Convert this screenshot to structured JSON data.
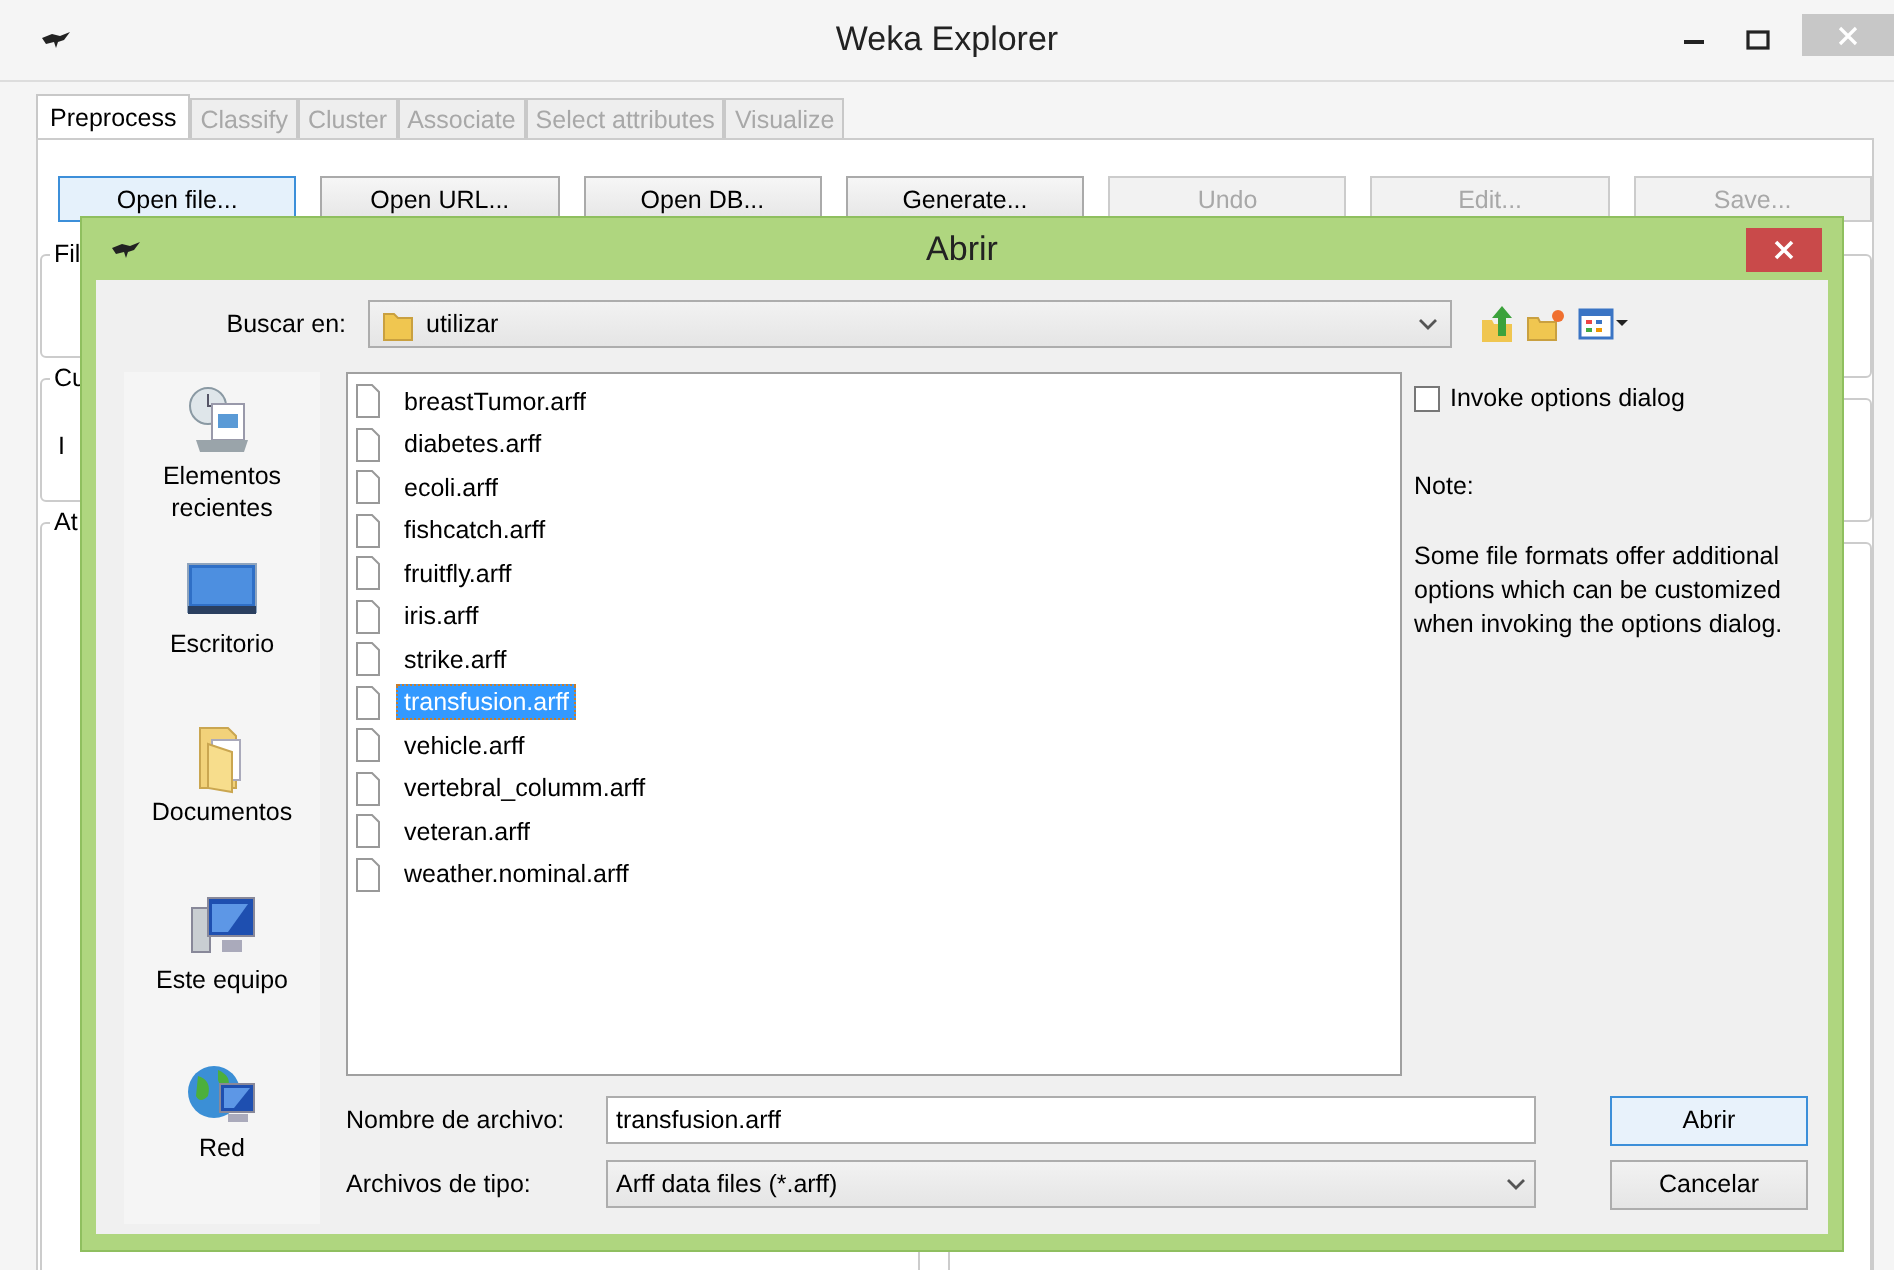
{
  "window": {
    "title": "Weka Explorer"
  },
  "tabs": [
    {
      "label": "Preprocess",
      "selected": true,
      "disabled": false
    },
    {
      "label": "Classify",
      "selected": false,
      "disabled": true
    },
    {
      "label": "Cluster",
      "selected": false,
      "disabled": true
    },
    {
      "label": "Associate",
      "selected": false,
      "disabled": true
    },
    {
      "label": "Select attributes",
      "selected": false,
      "disabled": true
    },
    {
      "label": "Visualize",
      "selected": false,
      "disabled": true
    }
  ],
  "toolbar_buttons": [
    {
      "label": "Open file...",
      "disabled": false,
      "focused": true
    },
    {
      "label": "Open URL...",
      "disabled": false,
      "focused": false
    },
    {
      "label": "Open DB...",
      "disabled": false,
      "focused": false
    },
    {
      "label": "Generate...",
      "disabled": false,
      "focused": false
    },
    {
      "label": "Undo",
      "disabled": true,
      "focused": false
    },
    {
      "label": "Edit...",
      "disabled": true,
      "focused": false
    },
    {
      "label": "Save...",
      "disabled": true,
      "focused": false
    }
  ],
  "panel_labels": [
    "Fil",
    "Cu",
    "At"
  ],
  "relation_fragment": "I",
  "dialog": {
    "title": "Abrir",
    "look_in_label": "Buscar en:",
    "look_in": "utilizar",
    "places": [
      {
        "label": "Elementos recientes",
        "kind": "recent"
      },
      {
        "label": "Escritorio",
        "kind": "desktop"
      },
      {
        "label": "Documentos",
        "kind": "documents"
      },
      {
        "label": "Este equipo",
        "kind": "computer"
      },
      {
        "label": "Red",
        "kind": "network"
      }
    ],
    "files": [
      {
        "name": "breastTumor.arff",
        "selected": false
      },
      {
        "name": "diabetes.arff",
        "selected": false
      },
      {
        "name": "ecoli.arff",
        "selected": false
      },
      {
        "name": "fishcatch.arff",
        "selected": false
      },
      {
        "name": "fruitfly.arff",
        "selected": false
      },
      {
        "name": "iris.arff",
        "selected": false
      },
      {
        "name": "strike.arff",
        "selected": false
      },
      {
        "name": "transfusion.arff",
        "selected": true
      },
      {
        "name": "vehicle.arff",
        "selected": false
      },
      {
        "name": "vertebral_columm.arff",
        "selected": false
      },
      {
        "name": "veteran.arff",
        "selected": false
      },
      {
        "name": "weather.nominal.arff",
        "selected": false
      }
    ],
    "invoke_options": {
      "label": "Invoke options dialog",
      "checked": false
    },
    "note_title": "Note:",
    "note_text": "Some file formats offer additional options which can be customized when invoking the options dialog.",
    "file_name_label": "Nombre de archivo:",
    "file_name": "transfusion.arff",
    "file_type_label": "Archivos de tipo:",
    "file_type": "Arff data files (*.arff)",
    "buttons": [
      {
        "label": "Abrir",
        "default": true
      },
      {
        "label": "Cancelar",
        "default": false
      }
    ]
  }
}
